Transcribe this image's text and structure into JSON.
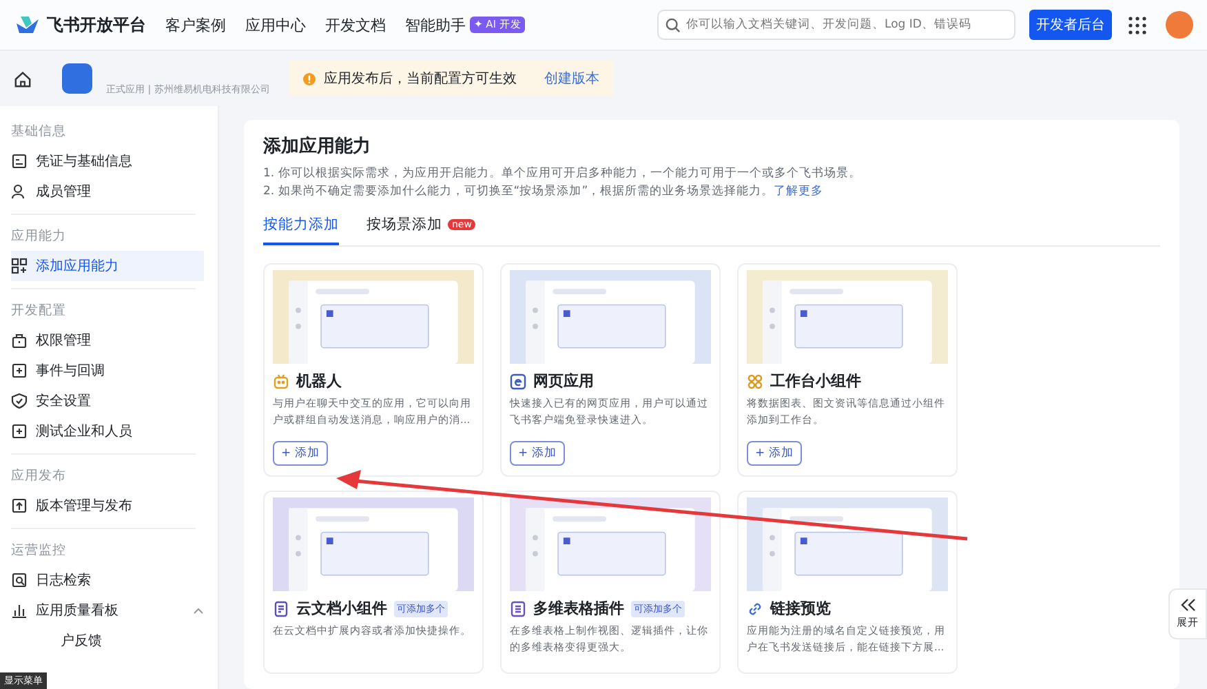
{
  "header": {
    "brand": "飞书开放平台",
    "nav": [
      {
        "label": "客户案例"
      },
      {
        "label": "应用中心"
      },
      {
        "label": "开发文档"
      },
      {
        "label": "智能助手",
        "badge": "✦ AI 开发"
      }
    ],
    "search": {
      "placeholder": "你可以输入文档关键词、开发问题、Log ID、错误码"
    },
    "console_button": "开发者后台"
  },
  "app": {
    "subtitle": "正式应用 | 苏州维易机电科技有限公司"
  },
  "notice": {
    "text": "应用发布后，当前配置方可生效",
    "link": "创建版本"
  },
  "sidebar": {
    "groups": [
      {
        "title": "基础信息",
        "items": [
          {
            "label": "凭证与基础信息",
            "selected": false
          },
          {
            "label": "成员管理",
            "selected": false
          }
        ]
      },
      {
        "title": "应用能力",
        "items": [
          {
            "label": "添加应用能力",
            "selected": true
          }
        ]
      },
      {
        "title": "开发配置",
        "items": [
          {
            "label": "权限管理",
            "selected": false
          },
          {
            "label": "事件与回调",
            "selected": false
          },
          {
            "label": "安全设置",
            "selected": false
          },
          {
            "label": "测试企业和人员",
            "selected": false
          }
        ]
      },
      {
        "title": "应用发布",
        "items": [
          {
            "label": "版本管理与发布",
            "selected": false
          }
        ]
      },
      {
        "title": "运营监控",
        "items": [
          {
            "label": "日志检索",
            "selected": false
          },
          {
            "label": "应用质量看板",
            "selected": false,
            "expanded": true
          },
          {
            "label": "户反馈",
            "selected": false
          }
        ]
      }
    ]
  },
  "tooltip": "显示菜单",
  "main": {
    "title": "添加应用能力",
    "lines": [
      "1. 你可以根据实际需求，为应用开启能力。单个应用可开启多种能力，一个能力可用于一个或多个飞书场景。",
      "2. 如果尚不确定需要添加什么能力，可切换至“按场景添加”，根据所需的业务场景选择能力。"
    ],
    "learn_more": "了解更多",
    "tabs": [
      {
        "label": "按能力添加",
        "selected": true
      },
      {
        "label": "按场景添加",
        "selected": false,
        "badge": "new"
      }
    ],
    "cards": [
      {
        "title": "机器人",
        "color": "#f5e9cc",
        "desc": "与用户在聊天中交互的应用，它可以向用户或群组自动发送消息，响应用户的消...",
        "button": "+ 添加"
      },
      {
        "title": "网页应用",
        "color": "#dbe4f5",
        "desc": "快速接入已有的网页应用，用户可以通过飞书客户端免登录快速进入。",
        "button": "+ 添加"
      },
      {
        "title": "工作台小组件",
        "color": "#f4ecd0",
        "desc": "将数据图表、图文资讯等信息通过小组件添加到工作台。",
        "button": "+ 添加"
      },
      {
        "title": "云文档小组件",
        "color": "#dcd9f5",
        "desc": "在云文档中扩展内容或者添加快捷操作。",
        "badge": "可添加多个"
      },
      {
        "title": "多维表格插件",
        "color": "#e6e0f6",
        "desc": "在多维表格上制作视图、逻辑插件，让你的多维表格变得更强大。",
        "badge": "可添加多个"
      },
      {
        "title": "链接预览",
        "color": "#dde5f4",
        "desc": "应用能为注册的域名自定义链接预览，用户在飞书发送链接后，能在链接下方展..."
      }
    ]
  },
  "expand": {
    "label": "展开"
  }
}
